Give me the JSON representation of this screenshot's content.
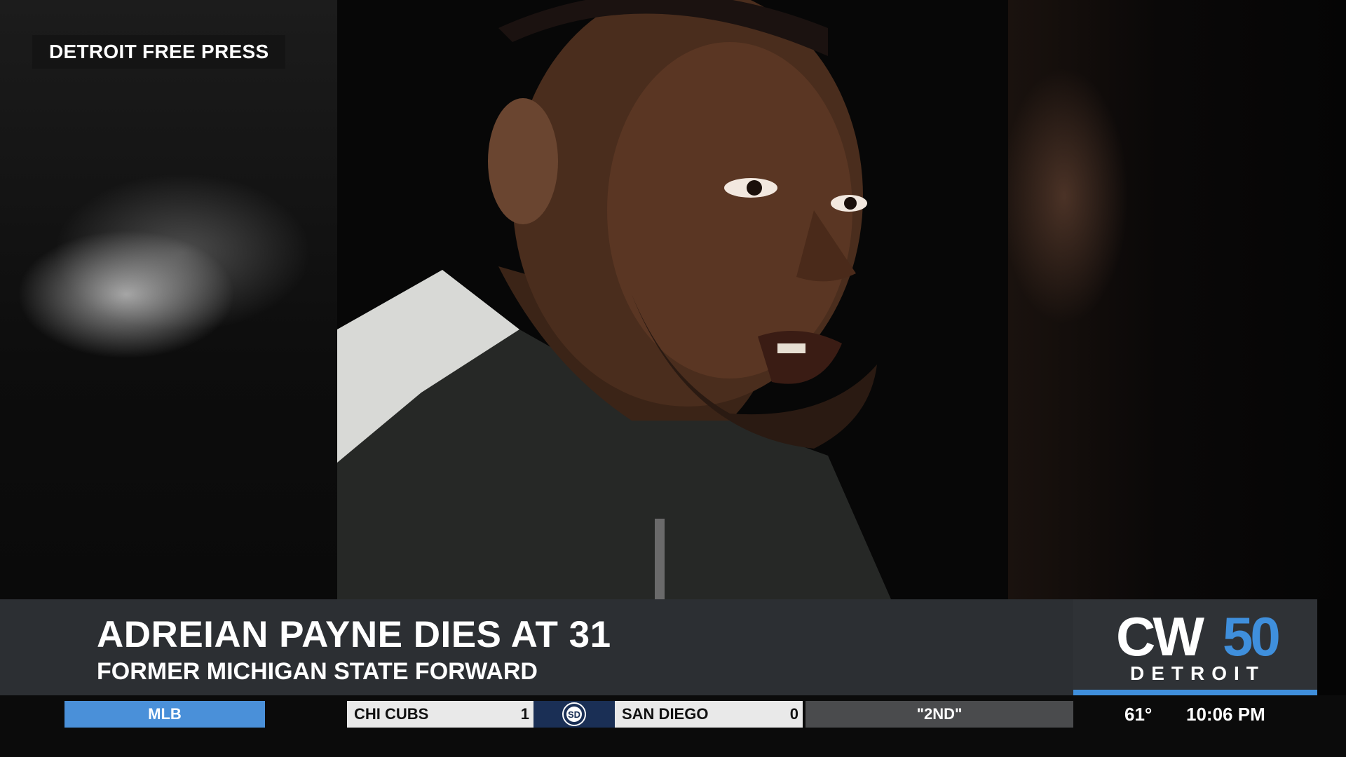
{
  "source_label": "DETROIT FREE PRESS",
  "lower_third": {
    "headline": "ADREIAN PAYNE DIES AT 31",
    "subhead": "FORMER MICHIGAN STATE FORWARD"
  },
  "station_logo": {
    "cw": "CW",
    "number": "50",
    "city": "DETROIT"
  },
  "ticker": {
    "league": "MLB",
    "away_team": "CHI CUBS",
    "away_score": "1",
    "team_logo_icon": "padres-sd-logo-icon",
    "home_team": "SAN DIEGO",
    "home_score": "0",
    "status": "\"2ND\"",
    "temperature": "61°",
    "time": "10:06 PM"
  },
  "colors": {
    "accent_blue": "#3f8fdc",
    "lower_third_bg": "#2c2f33",
    "ticker_bg": "#0b0b0b"
  }
}
